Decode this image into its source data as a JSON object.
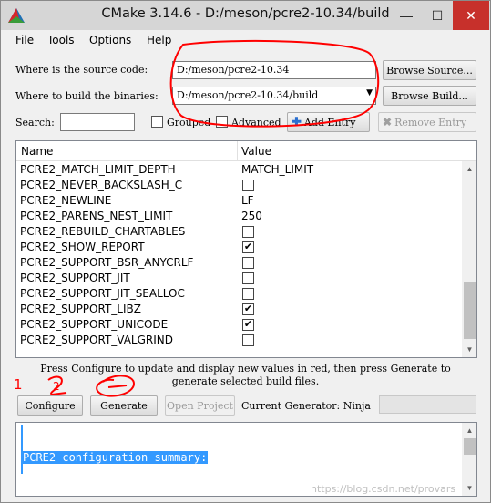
{
  "window": {
    "title": "CMake 3.14.6 - D:/meson/pcre2-10.34/build",
    "controls": {
      "minimize": "—",
      "maximize": "☐",
      "close": "✕"
    }
  },
  "menu": [
    "File",
    "Tools",
    "Options",
    "Help"
  ],
  "paths": {
    "source_label": "Where is the source code:",
    "source_value": "D:/meson/pcre2-10.34",
    "browse_source": "Browse Source...",
    "build_label": "Where to build the binaries:",
    "build_value": "D:/meson/pcre2-10.34/build",
    "browse_build": "Browse Build..."
  },
  "toolbar": {
    "search_label": "Search:",
    "search_value": "",
    "grouped": "Grouped",
    "advanced": "Advanced",
    "add_entry": "Add Entry",
    "remove_entry": "Remove Entry"
  },
  "table": {
    "headers": [
      "Name",
      "Value"
    ],
    "rows": [
      {
        "name": "PCRE2_MATCH_LIMIT_DEPTH",
        "type": "text",
        "value": "MATCH_LIMIT"
      },
      {
        "name": "PCRE2_NEVER_BACKSLASH_C",
        "type": "bool",
        "checked": false
      },
      {
        "name": "PCRE2_NEWLINE",
        "type": "text",
        "value": "LF"
      },
      {
        "name": "PCRE2_PARENS_NEST_LIMIT",
        "type": "text",
        "value": "250"
      },
      {
        "name": "PCRE2_REBUILD_CHARTABLES",
        "type": "bool",
        "checked": false
      },
      {
        "name": "PCRE2_SHOW_REPORT",
        "type": "bool",
        "checked": true
      },
      {
        "name": "PCRE2_SUPPORT_BSR_ANYCRLF",
        "type": "bool",
        "checked": false
      },
      {
        "name": "PCRE2_SUPPORT_JIT",
        "type": "bool",
        "checked": false
      },
      {
        "name": "PCRE2_SUPPORT_JIT_SEALLOC",
        "type": "bool",
        "checked": false
      },
      {
        "name": "PCRE2_SUPPORT_LIBZ",
        "type": "bool",
        "checked": true
      },
      {
        "name": "PCRE2_SUPPORT_UNICODE",
        "type": "bool",
        "checked": true
      },
      {
        "name": "PCRE2_SUPPORT_VALGRIND",
        "type": "bool",
        "checked": false
      }
    ]
  },
  "info_text": {
    "line1": "Press Configure to update and display new values in red, then press Generate to",
    "line2": "generate selected build files."
  },
  "actions": {
    "configure": "Configure",
    "generate": "Generate",
    "open_project": "Open Project",
    "generator_label": "Current Generator: Ninja"
  },
  "output": {
    "line": "PCRE2 configuration summary:"
  },
  "watermark": "https://blog.csdn.net/provars",
  "annotations": {
    "mark1": "1",
    "mark2": "2"
  },
  "colors": {
    "accent": "#3399ff",
    "annotation": "#ff0000",
    "close_button": "#c7302b"
  }
}
